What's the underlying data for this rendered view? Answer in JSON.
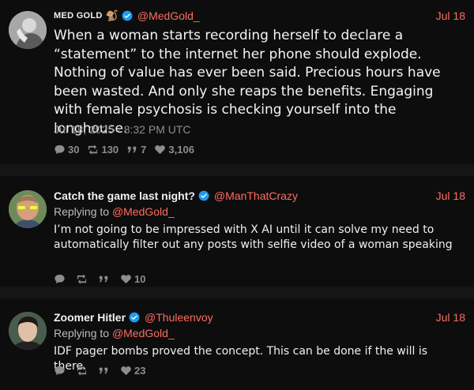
{
  "colors": {
    "accent": "#ff6c60",
    "background": "#0d0d0d",
    "verified": "#1d9bf0"
  },
  "tweets": [
    {
      "display_name": "MED GOLD",
      "emoji": "🐒",
      "handle": "@MedGold_",
      "date": "Jul 18",
      "text": "When a woman starts recording herself to declare a “statement” to the internet her phone should explode. Nothing of value has ever been said. Precious hours have been wasted. And only she reaps the benefits. Engaging with female psychosis is checking yourself into the longhouse.",
      "timestamp": "Jul 18, 2025 · 8:32 PM UTC",
      "stats": {
        "replies": "30",
        "retweets": "130",
        "quotes": "7",
        "likes": "3,106"
      }
    },
    {
      "display_name": "Catch the game last night?",
      "handle": "@ManThatCrazy",
      "date": "Jul 18",
      "replying_label": "Replying to",
      "replying_to": "@MedGold_",
      "text": "I’m not going to be impressed with X AI until it can solve my need to automatically filter out any posts with selfie video of a woman speaking",
      "stats": {
        "replies": "",
        "retweets": "",
        "quotes": "",
        "likes": "10"
      }
    },
    {
      "display_name": "Zoomer Hitler",
      "handle": "@Thuleenvoy",
      "date": "Jul 18",
      "replying_label": "Replying to",
      "replying_to": "@MedGold_",
      "text": "IDF pager bombs proved the concept. This can be done if the will is there.",
      "stats": {
        "replies": "",
        "retweets": "",
        "quotes": "",
        "likes": "23"
      }
    }
  ]
}
